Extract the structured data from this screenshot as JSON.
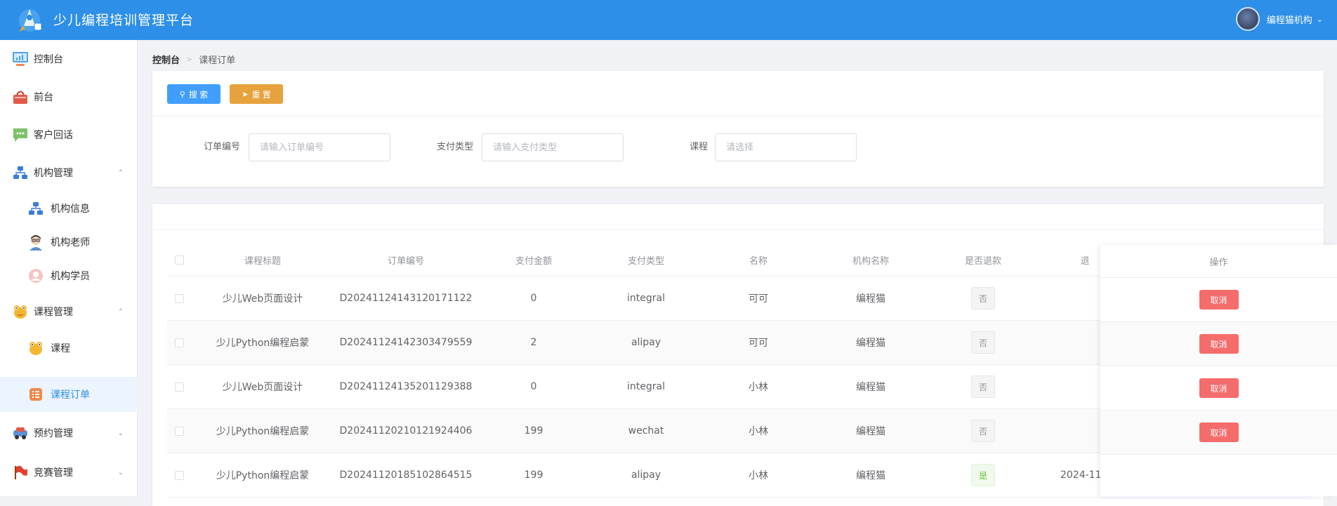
{
  "header": {
    "title": "少儿编程培训管理平台",
    "user_name": "编程猫机构"
  },
  "sidebar": {
    "items": [
      {
        "label": "控制台",
        "icon": "monitor-icon"
      },
      {
        "label": "前台",
        "icon": "basket-icon"
      },
      {
        "label": "客户回话",
        "icon": "chat-bubble-icon"
      },
      {
        "label": "机构管理",
        "icon": "org-chart-icon"
      },
      {
        "label": "机构信息",
        "icon": "org-chart-icon"
      },
      {
        "label": "机构老师",
        "icon": "teacher-icon"
      },
      {
        "label": "机构学员",
        "icon": "student-icon"
      },
      {
        "label": "课程管理",
        "icon": "frog-icon"
      },
      {
        "label": "课程",
        "icon": "frog-icon"
      },
      {
        "label": "课程订单",
        "icon": "list-icon"
      },
      {
        "label": "预约管理",
        "icon": "car-icon"
      },
      {
        "label": "竞赛管理",
        "icon": "flag-icon"
      }
    ]
  },
  "breadcrumb": {
    "home": "控制台",
    "current": "课程订单"
  },
  "toolbar": {
    "search_label": "搜 索",
    "reset_label": "重 置"
  },
  "filters": [
    {
      "label": "订单编号",
      "placeholder": "请输入订单编号"
    },
    {
      "label": "支付类型",
      "placeholder": "请输入支付类型"
    },
    {
      "label": "课程",
      "placeholder": "请选择"
    }
  ],
  "table": {
    "headers": {
      "title": "课程标题",
      "order_no": "订单编号",
      "amount": "支付金额",
      "pay_type": "支付类型",
      "name": "名称",
      "org": "机构名称",
      "refund": "是否退款",
      "refund_time": "退",
      "ops": "操作"
    },
    "rows": [
      {
        "title": "少儿Web页面设计",
        "order_no": "D20241124143120171122",
        "amount": "0",
        "pay_type": "integral",
        "name": "可可",
        "org": "编程猫",
        "refund": "否",
        "refund_time": "",
        "op": "取消"
      },
      {
        "title": "少儿Python编程启蒙",
        "order_no": "D20241124142303479559",
        "amount": "2",
        "pay_type": "alipay",
        "name": "可可",
        "org": "编程猫",
        "refund": "否",
        "refund_time": "",
        "op": "取消"
      },
      {
        "title": "少儿Web页面设计",
        "order_no": "D20241124135201129388",
        "amount": "0",
        "pay_type": "integral",
        "name": "小林",
        "org": "编程猫",
        "refund": "否",
        "refund_time": "",
        "op": "取消"
      },
      {
        "title": "少儿Python编程启蒙",
        "order_no": "D20241120210121924406",
        "amount": "199",
        "pay_type": "wechat",
        "name": "小林",
        "org": "编程猫",
        "refund": "否",
        "refund_time": "",
        "op": "取消"
      },
      {
        "title": "少儿Python编程启蒙",
        "order_no": "D20241120185102864515",
        "amount": "199",
        "pay_type": "alipay",
        "name": "小林",
        "org": "编程猫",
        "refund": "是",
        "refund_time": "2024-11",
        "op": ""
      }
    ]
  },
  "colors": {
    "header": "#2d8fe8",
    "primary": "#409eff",
    "warning": "#e6a23c",
    "danger": "#f56c6c",
    "success": "#67c23a"
  }
}
